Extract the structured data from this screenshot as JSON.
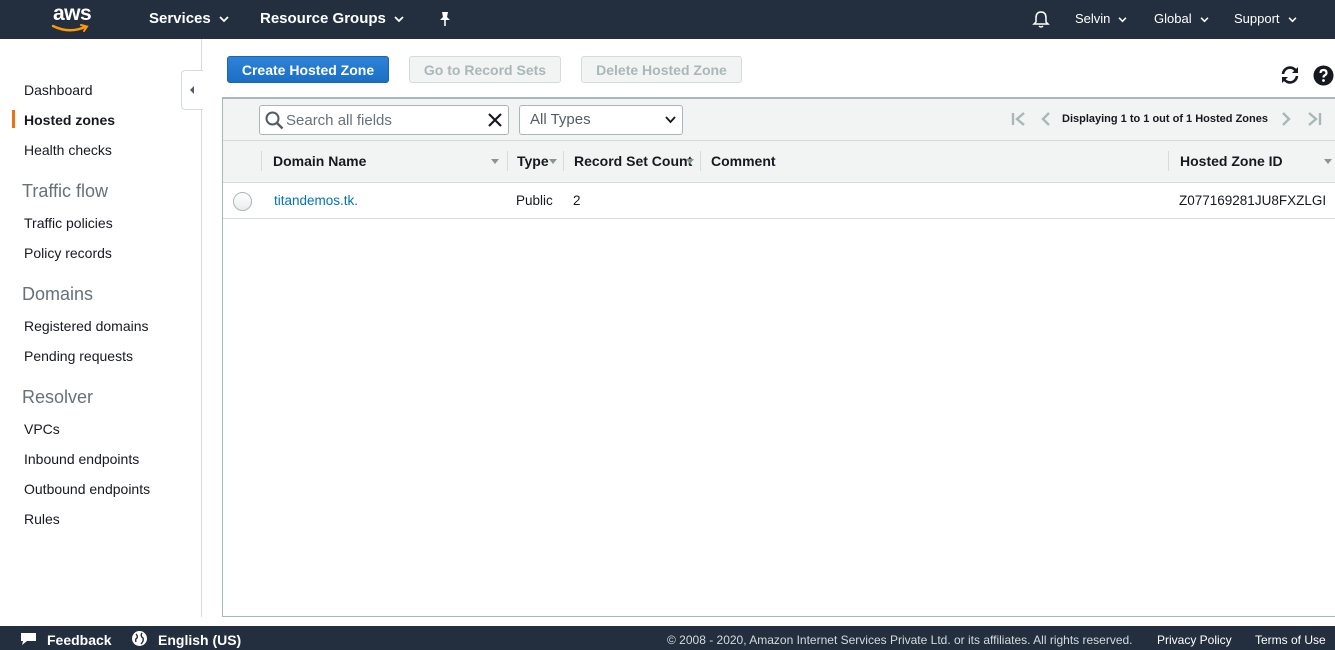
{
  "topnav": {
    "logo_text": "aws",
    "services": "Services",
    "resource_groups": "Resource Groups",
    "user": "Selvin",
    "region": "Global",
    "support": "Support"
  },
  "sidebar": {
    "dashboard": "Dashboard",
    "hosted_zones": "Hosted zones",
    "health_checks": "Health checks",
    "traffic_flow_heading": "Traffic flow",
    "traffic_policies": "Traffic policies",
    "policy_records": "Policy records",
    "domains_heading": "Domains",
    "registered_domains": "Registered domains",
    "pending_requests": "Pending requests",
    "resolver_heading": "Resolver",
    "vpcs": "VPCs",
    "inbound_endpoints": "Inbound endpoints",
    "outbound_endpoints": "Outbound endpoints",
    "rules": "Rules"
  },
  "toolbar": {
    "create_label": "Create Hosted Zone",
    "goto_label": "Go to Record Sets",
    "delete_label": "Delete Hosted Zone"
  },
  "filter": {
    "search_placeholder": "Search all fields",
    "type_selected": "All Types",
    "display_text": "Displaying 1 to 1 out of 1 Hosted Zones"
  },
  "table": {
    "columns": {
      "domain_name": "Domain Name",
      "type": "Type",
      "record_set_count": "Record Set Count",
      "comment": "Comment",
      "hosted_zone_id": "Hosted Zone ID"
    },
    "rows": [
      {
        "domain_name": "titandemos.tk.",
        "type": "Public",
        "record_set_count": "2",
        "comment": "",
        "hosted_zone_id": "Z077169281JU8FXZLGI"
      }
    ]
  },
  "footer": {
    "feedback": "Feedback",
    "language": "English (US)",
    "copyright": "© 2008 - 2020, Amazon Internet Services Private Ltd. or its affiliates. All rights reserved.",
    "privacy": "Privacy Policy",
    "terms": "Terms of Use"
  },
  "colors": {
    "nav_bg": "#232f3e",
    "accent_orange": "#ec7211",
    "primary_blue": "#1b6fc4",
    "link_blue": "#0073bb"
  }
}
